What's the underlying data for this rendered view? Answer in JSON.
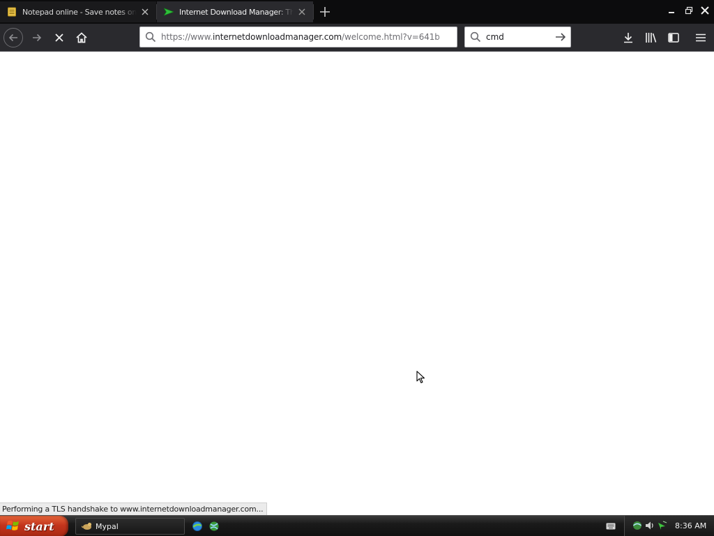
{
  "browser": {
    "tabs": [
      {
        "title": "Notepad online - Save notes online",
        "icon": "notepad-icon",
        "active": false
      },
      {
        "title": "Internet Download Manager: The fastest download accelerator",
        "icon": "idm-icon",
        "active": true
      }
    ],
    "address_bar": {
      "url_prefix": "https://www.",
      "url_host": "internetdownloadmanager.com",
      "url_path": "/welcome.html?v=641b"
    },
    "search_bar": {
      "value": "cmd"
    },
    "toolbar_icons": [
      "back-icon",
      "forward-icon",
      "stop-icon",
      "home-icon",
      "downloads-icon",
      "library-icon",
      "sidebar-icon",
      "menu-icon"
    ],
    "status_text": "Performing a TLS handshake to www.internetdownloadmanager.com..."
  },
  "taskbar": {
    "start_label": "start",
    "windows": [
      {
        "label": "Mypal",
        "icon": "mypal-icon"
      }
    ],
    "clock": "8:36 AM"
  },
  "colors": {
    "tabstrip_bg": "#0c0c0d",
    "toolbar_bg": "#2a2a2e",
    "start_button": "#c3351d"
  }
}
